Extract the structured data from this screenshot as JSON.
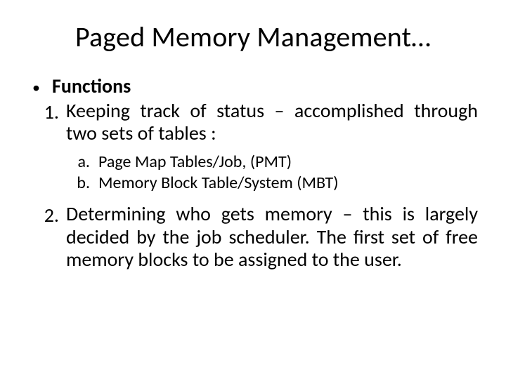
{
  "title": "Paged Memory Management…",
  "bullet": {
    "dot": "•",
    "label": "Functions"
  },
  "items": [
    {
      "marker": "1.",
      "text": "Keeping track of status – accomplished through two sets of tables :",
      "sub": [
        {
          "marker": "a.",
          "text": "Page Map Tables/Job, (PMT)"
        },
        {
          "marker": "b.",
          "text": "Memory Block Table/System (MBT)"
        }
      ]
    },
    {
      "marker": "2.",
      "text": "Determining who gets memory – this is largely decided by the job scheduler. The first set of free memory blocks to be assigned to the user."
    }
  ]
}
